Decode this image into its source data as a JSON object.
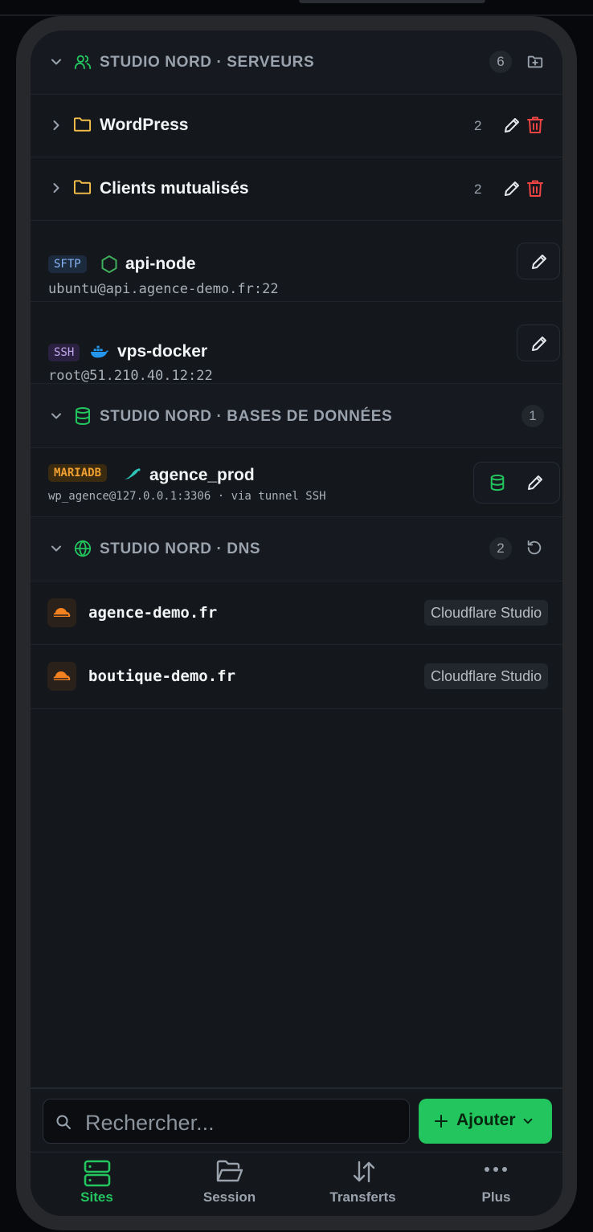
{
  "groups": {
    "servers": {
      "title": "STUDIO NORD · SERVEURS",
      "count": "6"
    },
    "databases": {
      "title": "STUDIO NORD · BASES DE DONNÉES",
      "count": "1"
    },
    "dns": {
      "title": "STUDIO NORD · DNS",
      "count": "2"
    }
  },
  "folders": [
    {
      "name": "WordPress",
      "count": "2"
    },
    {
      "name": "Clients mutualisés",
      "count": "2"
    }
  ],
  "servers": [
    {
      "protocol": "SFTP",
      "name": "api-node",
      "address": "ubuntu@api.agence-demo.fr:22",
      "icon": "nodejs-icon"
    },
    {
      "protocol": "SSH",
      "name": "vps-docker",
      "address": "root@51.210.40.12:22",
      "icon": "docker-icon"
    }
  ],
  "databases": [
    {
      "engine": "MARIADB",
      "name": "agence_prod",
      "address": "wp_agence@127.0.0.1:3306 · via tunnel SSH"
    }
  ],
  "dns": [
    {
      "domain": "agence-demo.fr",
      "provider": "Cloudflare Studio"
    },
    {
      "domain": "boutique-demo.fr",
      "provider": "Cloudflare Studio"
    }
  ],
  "search": {
    "placeholder": "Rechercher..."
  },
  "add_button": {
    "label": "Ajouter"
  },
  "nav": [
    {
      "label": "Sites",
      "active": true
    },
    {
      "label": "Session"
    },
    {
      "label": "Transferts"
    },
    {
      "label": "Plus"
    }
  ],
  "colors": {
    "accent": "#22c55e",
    "danger": "#ef4444",
    "folder": "#f5c04a",
    "cloudflare": "#f48120",
    "mariadb": "#f0a030",
    "sftp": "#8ab4f8",
    "ssh": "#c4a8f0"
  }
}
